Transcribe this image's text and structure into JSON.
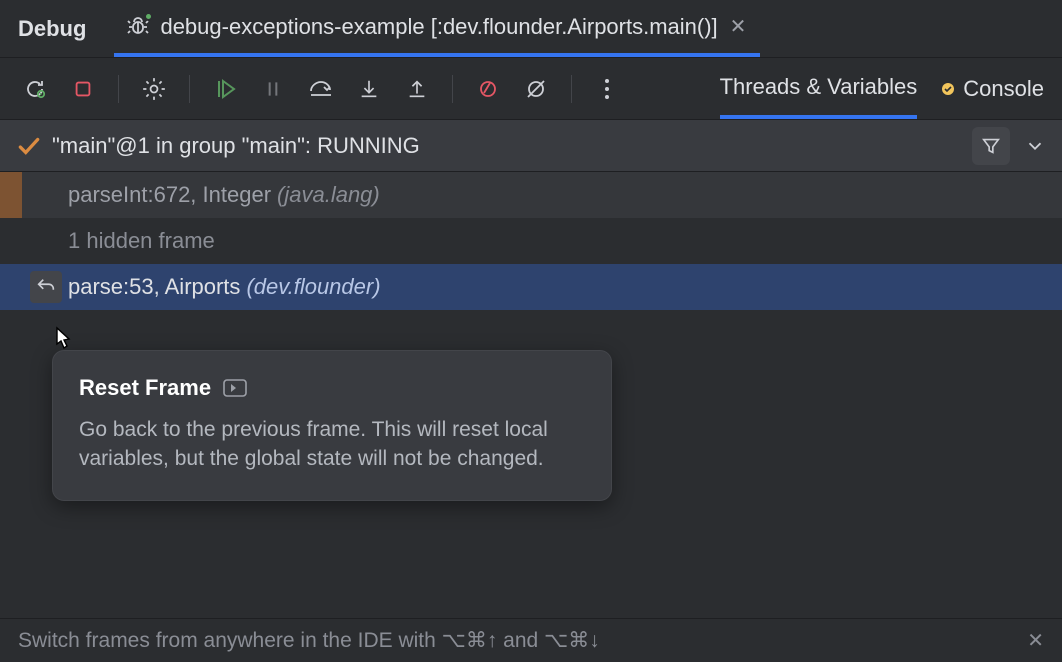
{
  "top": {
    "debug_label": "Debug",
    "run_config_label": "debug-exceptions-example [:dev.flounder.Airports.main()]"
  },
  "toolbar": {
    "rerun": "Rerun",
    "stop": "Stop",
    "view": "View Breakpoints",
    "resume": "Resume",
    "pause": "Pause",
    "step_over": "Step Over",
    "step_into": "Step Into",
    "step_out": "Step Out",
    "mute": "Mute Breakpoints",
    "more": "More"
  },
  "tabs": {
    "threads": "Threads & Variables",
    "console": "Console"
  },
  "thread": {
    "status": "\"main\"@1 in group \"main\": RUNNING"
  },
  "frames": [
    {
      "method": "parseInt:672, Integer",
      "pkg": "(java.lang)",
      "dim": true,
      "hasBar": true
    },
    {
      "method": "1 hidden frame",
      "pkg": "",
      "hidden": true
    },
    {
      "method": "parse:53, Airports",
      "pkg": "(dev.flounder)",
      "selected": true,
      "resetIcon": true
    }
  ],
  "tooltip": {
    "title": "Reset Frame",
    "body": "Go back to the previous frame. This will reset local variables, but the global state will not be changed."
  },
  "footer": {
    "hint": "Switch frames from anywhere in the IDE with ⌥⌘↑ and ⌥⌘↓"
  }
}
